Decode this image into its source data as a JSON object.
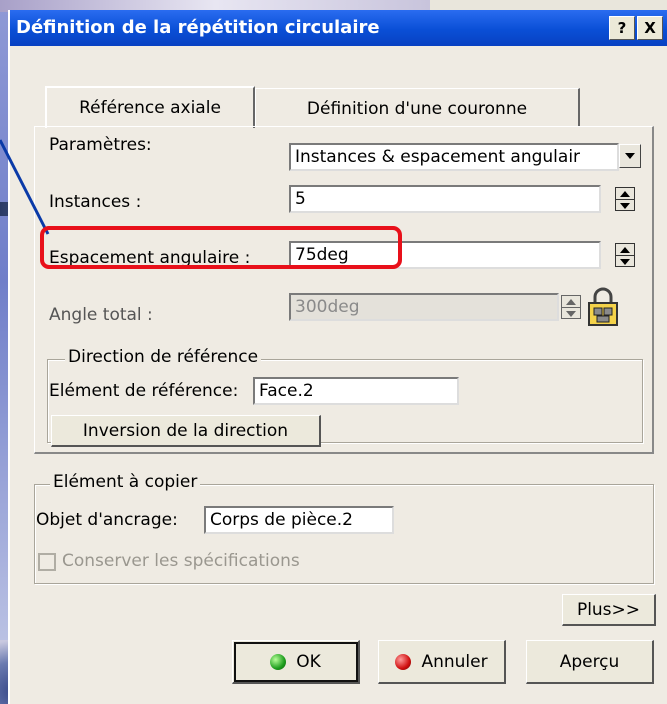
{
  "dialog": {
    "title": "Définition de la répétition circulaire",
    "help_label": "?",
    "close_label": "X"
  },
  "tabs": [
    {
      "label": "Référence axiale"
    },
    {
      "label": "Définition d'une couronne"
    }
  ],
  "params": {
    "parametres_label": "Paramètres:",
    "parametres_value": "Instances & espacement angulair",
    "instances_label": "Instances :",
    "instances_value": "5",
    "espacement_label": "Espacement angulaire :",
    "espacement_value": "75deg",
    "angle_total_label": "Angle total :",
    "angle_total_value": "300deg"
  },
  "direction": {
    "group_title": "Direction de référence",
    "element_label": "Elément de référence:",
    "element_value": "Face.2",
    "inversion_button": "Inversion de la direction"
  },
  "copy": {
    "group_title": "Elément à copier",
    "anchor_label": "Objet d'ancrage:",
    "anchor_value": "Corps de pièce.2",
    "keep_specs_label": "Conserver les spécifications"
  },
  "buttons": {
    "more": "Plus>>",
    "ok": "OK",
    "cancel": "Annuler",
    "preview": "Aperçu"
  },
  "icons": {
    "spin": "spin-up-down-icon",
    "lock": "lock-icon",
    "ok": "green-dot-icon",
    "cancel": "red-dot-icon"
  },
  "colors": {
    "titlebar": "#0a4fd6",
    "highlight": "#e8101a",
    "dialog_bg": "#efebe3"
  }
}
